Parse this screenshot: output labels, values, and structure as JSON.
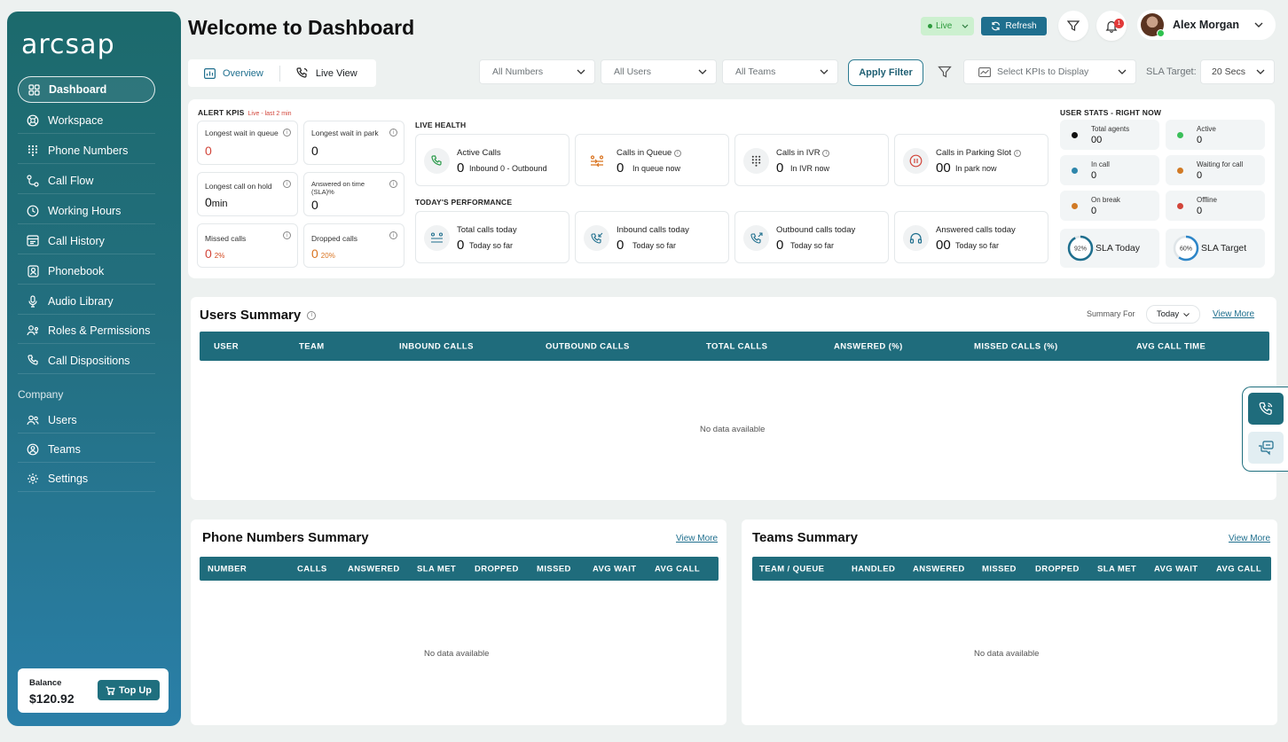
{
  "brand": {
    "logo_text": "arcsap"
  },
  "sidebar": {
    "items": [
      {
        "label": "Dashboard",
        "icon": "grid-icon",
        "active": true
      },
      {
        "label": "Workspace",
        "icon": "workspace-icon"
      },
      {
        "label": "Phone Numbers",
        "icon": "dialpad-icon"
      },
      {
        "label": "Call Flow",
        "icon": "flow-icon"
      },
      {
        "label": "Working Hours",
        "icon": "clock-icon"
      },
      {
        "label": "Call History",
        "icon": "history-icon"
      },
      {
        "label": "Phonebook",
        "icon": "phonebook-icon"
      },
      {
        "label": "Audio Library",
        "icon": "microphone-icon"
      },
      {
        "label": "Roles & Permissions",
        "icon": "roles-icon"
      },
      {
        "label": "Call Dispositions",
        "icon": "phone-icon"
      }
    ],
    "company_label": "Company",
    "company_items": [
      {
        "label": "Users",
        "icon": "users-icon"
      },
      {
        "label": "Teams",
        "icon": "teams-icon"
      },
      {
        "label": "Settings",
        "icon": "gear-icon"
      }
    ],
    "balance": {
      "label": "Balance",
      "value": "$120.92",
      "topup_label": "Top Up"
    }
  },
  "header": {
    "title": "Welcome to Dashboard",
    "live_label": "Live",
    "refresh_label": "Refresh",
    "notification_count": "1",
    "user_name": "Alex Morgan"
  },
  "tabs": [
    {
      "label": "Overview",
      "icon": "bar-chart-icon",
      "active": true
    },
    {
      "label": "Live View",
      "icon": "phone-live-icon",
      "active": false
    }
  ],
  "filters": {
    "numbers": "All Numbers",
    "users": "All Users",
    "teams": "All Teams",
    "apply_label": "Apply Filter",
    "kpi_select": "Select KPIs to Display",
    "sla_label": "SLA Target:",
    "sla_value": "20 Secs"
  },
  "alert_kpis": {
    "title": "ALERT KPIS",
    "subtitle": "Live - last 2 min",
    "cards": [
      {
        "label": "Longest wait in queue",
        "value": "0",
        "suffix": "",
        "alert": true
      },
      {
        "label": "Longest wait in park",
        "value": "0",
        "suffix": "",
        "alert": false
      },
      {
        "label": "Longest call on hold",
        "value": "0",
        "suffix": "min",
        "alert": false
      },
      {
        "label": "Answered on time (SLA)%",
        "value": "0",
        "suffix": "",
        "alert": false
      },
      {
        "label": "Missed calls",
        "value": "0",
        "suffix": "2%",
        "alert": true
      },
      {
        "label": "Dropped calls",
        "value": "0",
        "suffix": "20%",
        "alert": true,
        "orange": true
      }
    ]
  },
  "live_health": {
    "title": "LIVE HEALTH",
    "cards": [
      {
        "label": "Active Calls",
        "value": "0",
        "sub": "Inbound 0 - Outbound",
        "icon": "phone-call-icon",
        "color": "#2a9a4a"
      },
      {
        "label": "Calls in Queue",
        "value": "0",
        "sub": "In queue now",
        "icon": "queue-icon",
        "color": "#d9731f",
        "info": true
      },
      {
        "label": "Calls in IVR",
        "value": "0",
        "sub": "In IVR now",
        "icon": "keypad-icon",
        "color": "#333333",
        "info": true
      },
      {
        "label": "Calls in Parking Slot",
        "value": "00",
        "sub": "In park now",
        "icon": "pause-icon",
        "color": "#d2453a",
        "info": true
      }
    ]
  },
  "today_performance": {
    "title": "TODAY'S PERFORMANCE",
    "cards": [
      {
        "label": "Total calls today",
        "value": "0",
        "sub": "Today so far",
        "icon": "total-calls-icon"
      },
      {
        "label": "Inbound calls today",
        "value": "0",
        "sub": "Today so far",
        "icon": "inbound-call-icon"
      },
      {
        "label": "Outbound calls today",
        "value": "0",
        "sub": "Today so far",
        "icon": "outbound-call-icon"
      },
      {
        "label": "Answered calls today",
        "value": "00",
        "sub": "Today so far",
        "icon": "headset-icon"
      }
    ]
  },
  "user_stats": {
    "title": "USER STATS - RIGHT NOW",
    "cards": [
      {
        "label": "Total agents",
        "value": "00",
        "color": "#111111"
      },
      {
        "label": "Active",
        "value": "0",
        "color": "#3bbf5a"
      },
      {
        "label": "In call",
        "value": "0",
        "color": "#2e86ab"
      },
      {
        "label": "Waiting for call",
        "value": "0",
        "color": "#d17a25"
      },
      {
        "label": "On break",
        "value": "0",
        "color": "#d17a25"
      },
      {
        "label": "Offline",
        "value": "0",
        "color": "#d2453a"
      }
    ],
    "sla_today": {
      "label": "SLA Today",
      "percent_label": "92%",
      "percent": 92
    },
    "sla_target": {
      "label": "SLA Target",
      "percent_label": "60%",
      "percent": 60
    }
  },
  "users_summary": {
    "title": "Users Summary",
    "summary_for_label": "Summary For",
    "period": "Today",
    "view_more": "View More",
    "columns": [
      "USER",
      "TEAM",
      "INBOUND CALLS",
      "OUTBOUND CALLS",
      "TOTAL CALLS",
      "ANSWERED (%)",
      "MISSED CALLS (%)",
      "AVG CALL TIME"
    ],
    "empty": "No data available"
  },
  "phone_summary": {
    "title": "Phone Numbers Summary",
    "view_more": "View More",
    "columns": [
      "NUMBER",
      "CALLS",
      "ANSWERED",
      "SLA MET",
      "DROPPED",
      "MISSED",
      "AVG WAIT",
      "AVG CALL"
    ],
    "empty": "No data available"
  },
  "teams_summary": {
    "title": "Teams Summary",
    "view_more": "View More",
    "columns": [
      "TEAM / QUEUE",
      "HANDLED",
      "ANSWERED",
      "MISSED",
      "DROPPED",
      "SLA MET",
      "AVG WAIT",
      "AVG CALL"
    ],
    "empty": "No data available"
  },
  "floating": {
    "call_icon": "phone-icon",
    "chat_icon": "chat-icon"
  }
}
